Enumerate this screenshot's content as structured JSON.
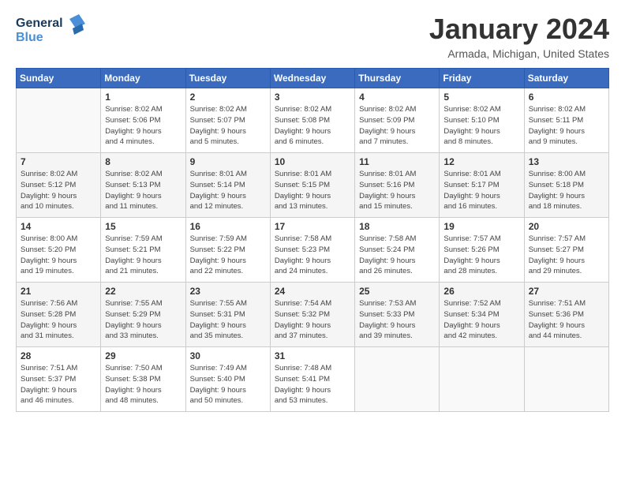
{
  "header": {
    "logo_line1": "General",
    "logo_line2": "Blue",
    "title": "January 2024",
    "subtitle": "Armada, Michigan, United States"
  },
  "weekdays": [
    "Sunday",
    "Monday",
    "Tuesday",
    "Wednesday",
    "Thursday",
    "Friday",
    "Saturday"
  ],
  "weeks": [
    [
      {
        "day": "",
        "info": ""
      },
      {
        "day": "1",
        "info": "Sunrise: 8:02 AM\nSunset: 5:06 PM\nDaylight: 9 hours\nand 4 minutes."
      },
      {
        "day": "2",
        "info": "Sunrise: 8:02 AM\nSunset: 5:07 PM\nDaylight: 9 hours\nand 5 minutes."
      },
      {
        "day": "3",
        "info": "Sunrise: 8:02 AM\nSunset: 5:08 PM\nDaylight: 9 hours\nand 6 minutes."
      },
      {
        "day": "4",
        "info": "Sunrise: 8:02 AM\nSunset: 5:09 PM\nDaylight: 9 hours\nand 7 minutes."
      },
      {
        "day": "5",
        "info": "Sunrise: 8:02 AM\nSunset: 5:10 PM\nDaylight: 9 hours\nand 8 minutes."
      },
      {
        "day": "6",
        "info": "Sunrise: 8:02 AM\nSunset: 5:11 PM\nDaylight: 9 hours\nand 9 minutes."
      }
    ],
    [
      {
        "day": "7",
        "info": "Sunrise: 8:02 AM\nSunset: 5:12 PM\nDaylight: 9 hours\nand 10 minutes."
      },
      {
        "day": "8",
        "info": "Sunrise: 8:02 AM\nSunset: 5:13 PM\nDaylight: 9 hours\nand 11 minutes."
      },
      {
        "day": "9",
        "info": "Sunrise: 8:01 AM\nSunset: 5:14 PM\nDaylight: 9 hours\nand 12 minutes."
      },
      {
        "day": "10",
        "info": "Sunrise: 8:01 AM\nSunset: 5:15 PM\nDaylight: 9 hours\nand 13 minutes."
      },
      {
        "day": "11",
        "info": "Sunrise: 8:01 AM\nSunset: 5:16 PM\nDaylight: 9 hours\nand 15 minutes."
      },
      {
        "day": "12",
        "info": "Sunrise: 8:01 AM\nSunset: 5:17 PM\nDaylight: 9 hours\nand 16 minutes."
      },
      {
        "day": "13",
        "info": "Sunrise: 8:00 AM\nSunset: 5:18 PM\nDaylight: 9 hours\nand 18 minutes."
      }
    ],
    [
      {
        "day": "14",
        "info": "Sunrise: 8:00 AM\nSunset: 5:20 PM\nDaylight: 9 hours\nand 19 minutes."
      },
      {
        "day": "15",
        "info": "Sunrise: 7:59 AM\nSunset: 5:21 PM\nDaylight: 9 hours\nand 21 minutes."
      },
      {
        "day": "16",
        "info": "Sunrise: 7:59 AM\nSunset: 5:22 PM\nDaylight: 9 hours\nand 22 minutes."
      },
      {
        "day": "17",
        "info": "Sunrise: 7:58 AM\nSunset: 5:23 PM\nDaylight: 9 hours\nand 24 minutes."
      },
      {
        "day": "18",
        "info": "Sunrise: 7:58 AM\nSunset: 5:24 PM\nDaylight: 9 hours\nand 26 minutes."
      },
      {
        "day": "19",
        "info": "Sunrise: 7:57 AM\nSunset: 5:26 PM\nDaylight: 9 hours\nand 28 minutes."
      },
      {
        "day": "20",
        "info": "Sunrise: 7:57 AM\nSunset: 5:27 PM\nDaylight: 9 hours\nand 29 minutes."
      }
    ],
    [
      {
        "day": "21",
        "info": "Sunrise: 7:56 AM\nSunset: 5:28 PM\nDaylight: 9 hours\nand 31 minutes."
      },
      {
        "day": "22",
        "info": "Sunrise: 7:55 AM\nSunset: 5:29 PM\nDaylight: 9 hours\nand 33 minutes."
      },
      {
        "day": "23",
        "info": "Sunrise: 7:55 AM\nSunset: 5:31 PM\nDaylight: 9 hours\nand 35 minutes."
      },
      {
        "day": "24",
        "info": "Sunrise: 7:54 AM\nSunset: 5:32 PM\nDaylight: 9 hours\nand 37 minutes."
      },
      {
        "day": "25",
        "info": "Sunrise: 7:53 AM\nSunset: 5:33 PM\nDaylight: 9 hours\nand 39 minutes."
      },
      {
        "day": "26",
        "info": "Sunrise: 7:52 AM\nSunset: 5:34 PM\nDaylight: 9 hours\nand 42 minutes."
      },
      {
        "day": "27",
        "info": "Sunrise: 7:51 AM\nSunset: 5:36 PM\nDaylight: 9 hours\nand 44 minutes."
      }
    ],
    [
      {
        "day": "28",
        "info": "Sunrise: 7:51 AM\nSunset: 5:37 PM\nDaylight: 9 hours\nand 46 minutes."
      },
      {
        "day": "29",
        "info": "Sunrise: 7:50 AM\nSunset: 5:38 PM\nDaylight: 9 hours\nand 48 minutes."
      },
      {
        "day": "30",
        "info": "Sunrise: 7:49 AM\nSunset: 5:40 PM\nDaylight: 9 hours\nand 50 minutes."
      },
      {
        "day": "31",
        "info": "Sunrise: 7:48 AM\nSunset: 5:41 PM\nDaylight: 9 hours\nand 53 minutes."
      },
      {
        "day": "",
        "info": ""
      },
      {
        "day": "",
        "info": ""
      },
      {
        "day": "",
        "info": ""
      }
    ]
  ]
}
